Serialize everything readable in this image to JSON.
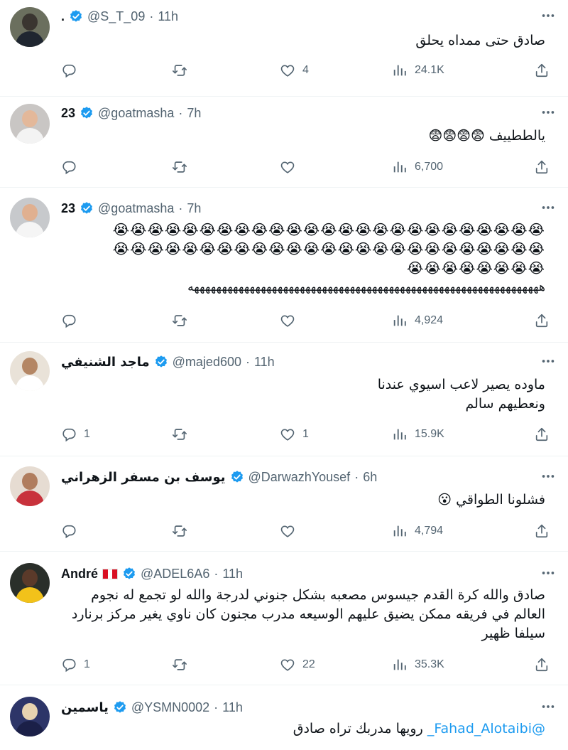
{
  "tweets": [
    {
      "name": ".",
      "handle": "@S_T_09",
      "time": "11h",
      "text": "صادق حتى ممداه يحلق",
      "replies": "",
      "retweets": "",
      "likes": "4",
      "views": "24.1K",
      "avatar_colors": {
        "bg": "#6b6f5e",
        "head": "#3a3530",
        "body": "#1f2630"
      }
    },
    {
      "name": "23",
      "handle": "@goatmasha",
      "time": "7h",
      "text": "يالططييف 😨😨😨😨",
      "replies": "",
      "retweets": "",
      "likes": "",
      "views": "6,700",
      "avatar_colors": {
        "bg": "#c9c6c4",
        "head": "#e3b89a",
        "body": "#f3f3f3"
      }
    },
    {
      "name": "23",
      "handle": "@goatmasha",
      "time": "7h",
      "emoji_line_1": "😭😭😭😭😭😭😭😭😭😭😭😭😭😭😭😭😭😭😭😭😭😭😭😭😭",
      "emoji_line_2": "😭😭😭😭😭😭😭😭😭😭😭😭😭😭😭😭😭😭😭😭😭😭😭😭😭",
      "emoji_line_3": "😭😭😭😭😭😭😭😭",
      "text_line_4": "هههههههههههههههههههههههههههههههههههههههههههههههههههههههههههههههه",
      "replies": "",
      "retweets": "",
      "likes": "",
      "views": "4,924",
      "avatar_colors": {
        "bg": "#c7c9cc",
        "head": "#e0b090",
        "body": "#f5f5f5"
      }
    },
    {
      "name": "ماجد الشنيفي",
      "handle": "@majed600",
      "time": "11h",
      "text_line_1": "ماوده يصير لاعب اسيوي عندنا",
      "text_line_2": "ونعطيهم سالم",
      "replies": "1",
      "retweets": "",
      "likes": "1",
      "views": "15.9K",
      "avatar_colors": {
        "bg": "#e9e2d8",
        "head": "#b48664",
        "body": "#ffffff"
      }
    },
    {
      "name": "يوسف بن مسفر الزهراني",
      "handle": "@DarwazhYousef",
      "time": "6h",
      "text": "فشلونا الطواقي 😮",
      "replies": "",
      "retweets": "",
      "likes": "",
      "views": "4,794",
      "avatar_colors": {
        "bg": "#e6dcd2",
        "head": "#b07d5e",
        "body": "#c8323c"
      }
    },
    {
      "name": "André",
      "handle": "@ADEL6A6",
      "time": "11h",
      "text_line_1": "صادق والله كرة القدم جيسوس مصعبه بشكل جنوني لدرجة والله لو تجمع له نجوم",
      "text_line_2": "العالم في فريقه ممكن يضيق عليهم الوسيعه مدرب مجنون كان ناوي يغير مركز برنارد",
      "text_line_3": "سيلفا ظهير",
      "replies": "1",
      "retweets": "",
      "likes": "22",
      "views": "35.3K",
      "avatar_colors": {
        "bg": "#2a2f2a",
        "head": "#5b3a2a",
        "body": "#f2c21a"
      }
    },
    {
      "name": "ياسمين",
      "handle": "@YSMN0002",
      "time": "11h",
      "mention": "@Fahad_Alotaibi_",
      "text": "رويها مدربك تراه صادق",
      "avatar_colors": {
        "bg": "#2d3568",
        "head": "#e7d3b0",
        "body": "#1b2048"
      }
    }
  ],
  "icons": {
    "reply": "reply-icon",
    "retweet": "retweet-icon",
    "like": "heart-icon",
    "views": "views-icon",
    "share": "share-icon",
    "more": "more-icon",
    "verified": "verified-badge-icon",
    "flag": "peru-flag-icon"
  },
  "colors": {
    "accent": "#1d9bf0",
    "secondary_text": "#536471",
    "divider": "#eff3f4",
    "flag_red": "#d91023"
  }
}
